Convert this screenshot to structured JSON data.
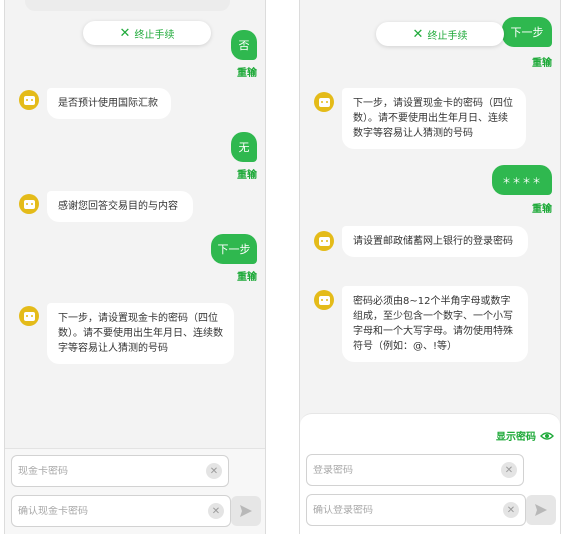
{
  "left": {
    "stop_label": "终止手续",
    "messages": {
      "u1": "否",
      "u1_reinput": "重输",
      "b1": "是否预计使用国际汇款",
      "u2": "无",
      "u2_reinput": "重输",
      "b2": "感谢您回答交易目的与内容",
      "u3": "下一步",
      "u3_reinput": "重输",
      "b3": "下一步，请设置现金卡的密码（四位数）。请不要使用出生年月日、连续数字等容易让人猜测的号码"
    },
    "inputs": {
      "password_placeholder": "现金卡密码",
      "confirm_placeholder": "确认现金卡密码"
    }
  },
  "right": {
    "stop_label": "终止手续",
    "messages": {
      "u1": "下一步",
      "u1_reinput": "重输",
      "b1": "下一步，请设置现金卡的密码（四位数）。请不要使用出生年月日、连续数字等容易让人猜测的号码",
      "u2": "＊＊＊＊",
      "u2_reinput": "重输",
      "b2": "请设置邮政储蓄网上银行的登录密码",
      "b3": "密码必须由8~12个半角字母或数字组成，至少包含一个数字、一个小写字母和一个大写字母。请勿使用特殊符号（例如：@、!等）"
    },
    "show_password_label": "显示密码",
    "inputs": {
      "password_placeholder": "登录密码",
      "confirm_placeholder": "确认登录密码"
    }
  },
  "icons": {
    "close": "close-icon",
    "send": "send-icon",
    "eye": "eye-icon",
    "bot": "bot-avatar-icon",
    "clear": "clear-icon"
  },
  "colors": {
    "accent_green": "#2fb84f",
    "text_green": "#1faa3a",
    "bot_yellow": "#e4bb19",
    "chat_bg": "#f3f3f3"
  }
}
